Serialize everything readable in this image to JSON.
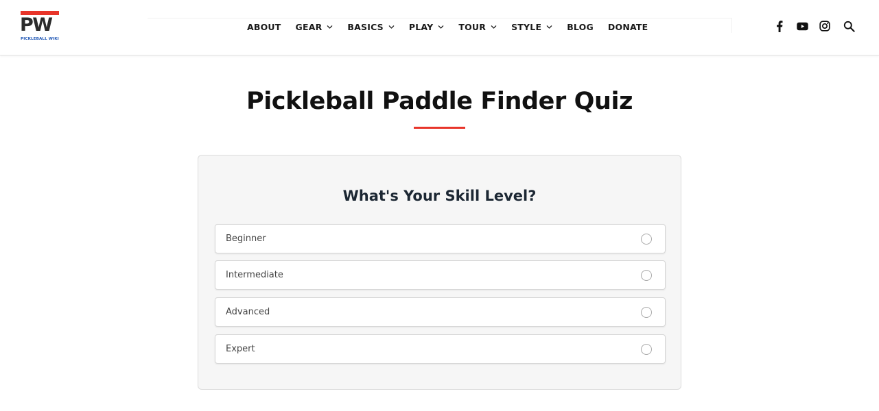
{
  "logo": {
    "mark": "PW",
    "subtitle": "PICKLEBALL WIKI",
    "accent_color": "#e8352a",
    "subtitle_color": "#1e56b5"
  },
  "nav": {
    "items": [
      {
        "label": "ABOUT",
        "dropdown": false
      },
      {
        "label": "GEAR",
        "dropdown": true
      },
      {
        "label": "BASICS",
        "dropdown": true
      },
      {
        "label": "PLAY",
        "dropdown": true
      },
      {
        "label": "TOUR",
        "dropdown": true
      },
      {
        "label": "STYLE",
        "dropdown": true
      },
      {
        "label": "BLOG",
        "dropdown": false
      },
      {
        "label": "DONATE",
        "dropdown": false
      }
    ]
  },
  "header_icons": [
    "facebook-icon",
    "youtube-icon",
    "instagram-icon",
    "search-icon"
  ],
  "page": {
    "title": "Pickleball Paddle Finder Quiz",
    "accent_color": "#e8352a"
  },
  "quiz": {
    "question": "What's Your Skill Level?",
    "options": [
      {
        "label": "Beginner",
        "selected": false
      },
      {
        "label": "Intermediate",
        "selected": false
      },
      {
        "label": "Advanced",
        "selected": false
      },
      {
        "label": "Expert",
        "selected": false
      }
    ]
  }
}
